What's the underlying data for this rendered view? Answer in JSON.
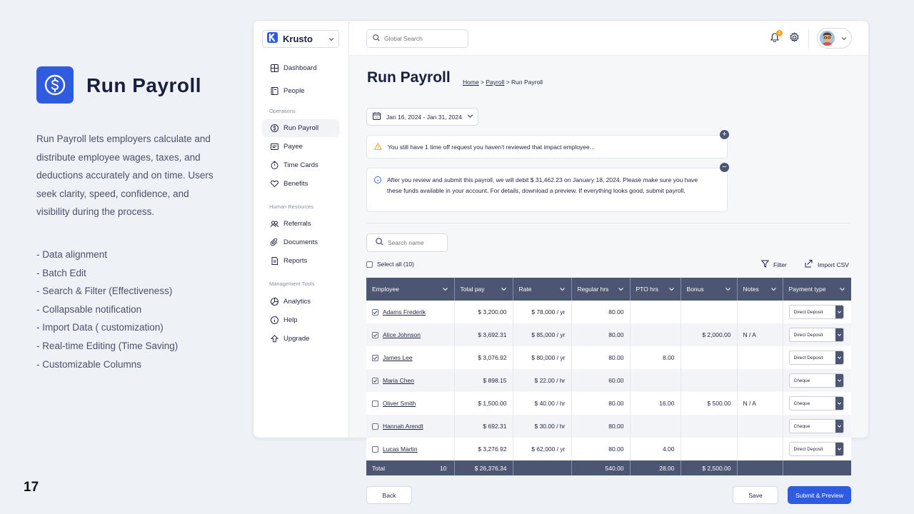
{
  "slide": {
    "title": "Run Payroll",
    "icon": "dollar-circle-icon",
    "description": "Run Payroll lets employers calculate and distribute employee wages, taxes, and deductions accurately and on time. Users seek clarity, speed, confidence, and visibility during the process.",
    "features": [
      "- Data alignment",
      "- Batch Edit",
      "- Search & Filter (Effectiveness)",
      "- Collapsable notification",
      "- Import Data ( customization)",
      "- Real-time Editing (Time Saving)",
      "- Customizable Columns"
    ],
    "page_number": "17"
  },
  "app": {
    "brand": "Krusto",
    "search_placeholder": "Global Search",
    "notification_count": "1",
    "nav": {
      "main": [
        {
          "label": "Dashboard",
          "icon": "grid-icon"
        },
        {
          "label": "People",
          "icon": "book-icon"
        }
      ],
      "operations_label": "Operations",
      "operations": [
        {
          "label": "Run Payroll",
          "icon": "dollar-icon"
        },
        {
          "label": "Payee",
          "icon": "card-icon"
        },
        {
          "label": "Time Cards",
          "icon": "timer-icon"
        },
        {
          "label": "Benefits",
          "icon": "heart-icon"
        }
      ],
      "hr_label": "Human Resources",
      "hr": [
        {
          "label": "Referrals",
          "icon": "users-icon"
        },
        {
          "label": "Documents",
          "icon": "paperclip-icon"
        },
        {
          "label": "Reports",
          "icon": "report-icon"
        }
      ],
      "management_label": "Management Tools",
      "management": [
        {
          "label": "Analytics",
          "icon": "analytics-icon"
        },
        {
          "label": "Help",
          "icon": "info-icon"
        },
        {
          "label": "Upgrade",
          "icon": "upgrade-icon"
        }
      ]
    },
    "page_title": "Run Payroll",
    "breadcrumb": {
      "home": "Home",
      "sep1": " > ",
      "payroll": "Payroll",
      "sep2": " > ",
      "current": "Run Payroll"
    },
    "date_range": "Jan 16, 2024 - Jan 31, 2024",
    "warning_notice": "You still have 1 time off request you haven't reviewed that impact employee...",
    "info_notice": "After you review and submit this payroll, we will debit $ 31,462.23 on January 18, 2024. Please make sure you have these funds available in your account. For details, download a preview. If everything looks good, submit payroll.",
    "search_name_placeholder": "Search name",
    "select_all": "Select all (10)",
    "filter_label": "Filter",
    "import_label": "Import CSV",
    "columns": [
      "Employee",
      "Total pay",
      "Rate",
      "Regular hrs",
      "PTO hrs",
      "Bonus",
      "Notes",
      "Payment type"
    ],
    "rows": [
      {
        "checked": true,
        "name": "Adams Frederik",
        "total": "$ 3,200.00",
        "rate": "$ 78,000 / yr",
        "regular": "80.00",
        "pto": "",
        "bonus": "",
        "notes": "",
        "payment": "Direct Deposit"
      },
      {
        "checked": true,
        "name": "Alice Johnson",
        "total": "$ 3,692.31",
        "rate": "$ 85,000 / yr",
        "regular": "80.00",
        "pto": "",
        "bonus": "$ 2,000.00",
        "notes": "N / A",
        "payment": "Direct Deposit"
      },
      {
        "checked": true,
        "name": "James Lee",
        "total": "$ 3,076.92",
        "rate": "$ 80,000 / yr",
        "regular": "80.00",
        "pto": "8.00",
        "bonus": "",
        "notes": "",
        "payment": "Direct Deposit"
      },
      {
        "checked": true,
        "name": "Maria Chen",
        "total": "$ 898.15",
        "rate": "$ 22.00 / hr",
        "regular": "60.00",
        "pto": "",
        "bonus": "",
        "notes": "",
        "payment": "Cheque"
      },
      {
        "checked": false,
        "name": "Oliver Smith",
        "total": "$ 1,500.00",
        "rate": "$ 40.00 / hr",
        "regular": "80.00",
        "pto": "16.00",
        "bonus": "$ 500.00",
        "notes": "N / A",
        "payment": "Cheque"
      },
      {
        "checked": false,
        "name": "Hannah Arendt",
        "total": "$ 692.31",
        "rate": "$ 30.00 / hr",
        "regular": "80.00",
        "pto": "",
        "bonus": "",
        "notes": "",
        "payment": "Cheque"
      },
      {
        "checked": false,
        "name": "Lucas Martin",
        "total": "$ 3,276.92",
        "rate": "$ 62,000 / yr",
        "regular": "80.00",
        "pto": "4.00",
        "bonus": "",
        "notes": "",
        "payment": "Direct Deposit"
      }
    ],
    "totals": {
      "label": "Total",
      "count": "10",
      "total": "$ 26,376.34",
      "rate": "",
      "regular": "540.00",
      "pto": "28.00",
      "bonus": "$ 2,500.00",
      "notes": "",
      "payment": ""
    },
    "buttons": {
      "back": "Back",
      "save": "Save",
      "submit": "Submit & Preview"
    },
    "colors": {
      "primary": "#2f5be0",
      "header": "#4c5572",
      "warning": "#f5a524"
    }
  }
}
